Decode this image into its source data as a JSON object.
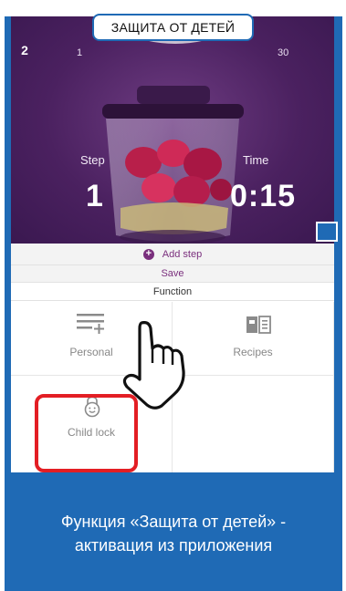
{
  "header": {
    "step_number": "2",
    "title": "ЗАЩИТА ОТ ДЕТЕЙ"
  },
  "hero": {
    "dial_min": "1",
    "dial_max": "30",
    "step_label": "Step",
    "step_value": "1",
    "time_label": "Time",
    "time_value": "0:15",
    "carousel_pages": 2,
    "carousel_active": 1
  },
  "actions": {
    "add_step": "Add step",
    "save": "Save",
    "function_header": "Function"
  },
  "functions": [
    {
      "label": "Personal",
      "icon": "playlist-add-icon"
    },
    {
      "label": "Recipes",
      "icon": "book-icon"
    },
    {
      "label": "Child lock",
      "icon": "smiley-lock-icon"
    }
  ],
  "caption": {
    "line1": "Функция «Защита от детей» -",
    "line2": "активация из приложения"
  },
  "colors": {
    "frame_blue": "#1f6ab5",
    "accent_purple": "#7a2f7d",
    "highlight_red": "#e31e24",
    "hero_purple": "#4b2160"
  }
}
